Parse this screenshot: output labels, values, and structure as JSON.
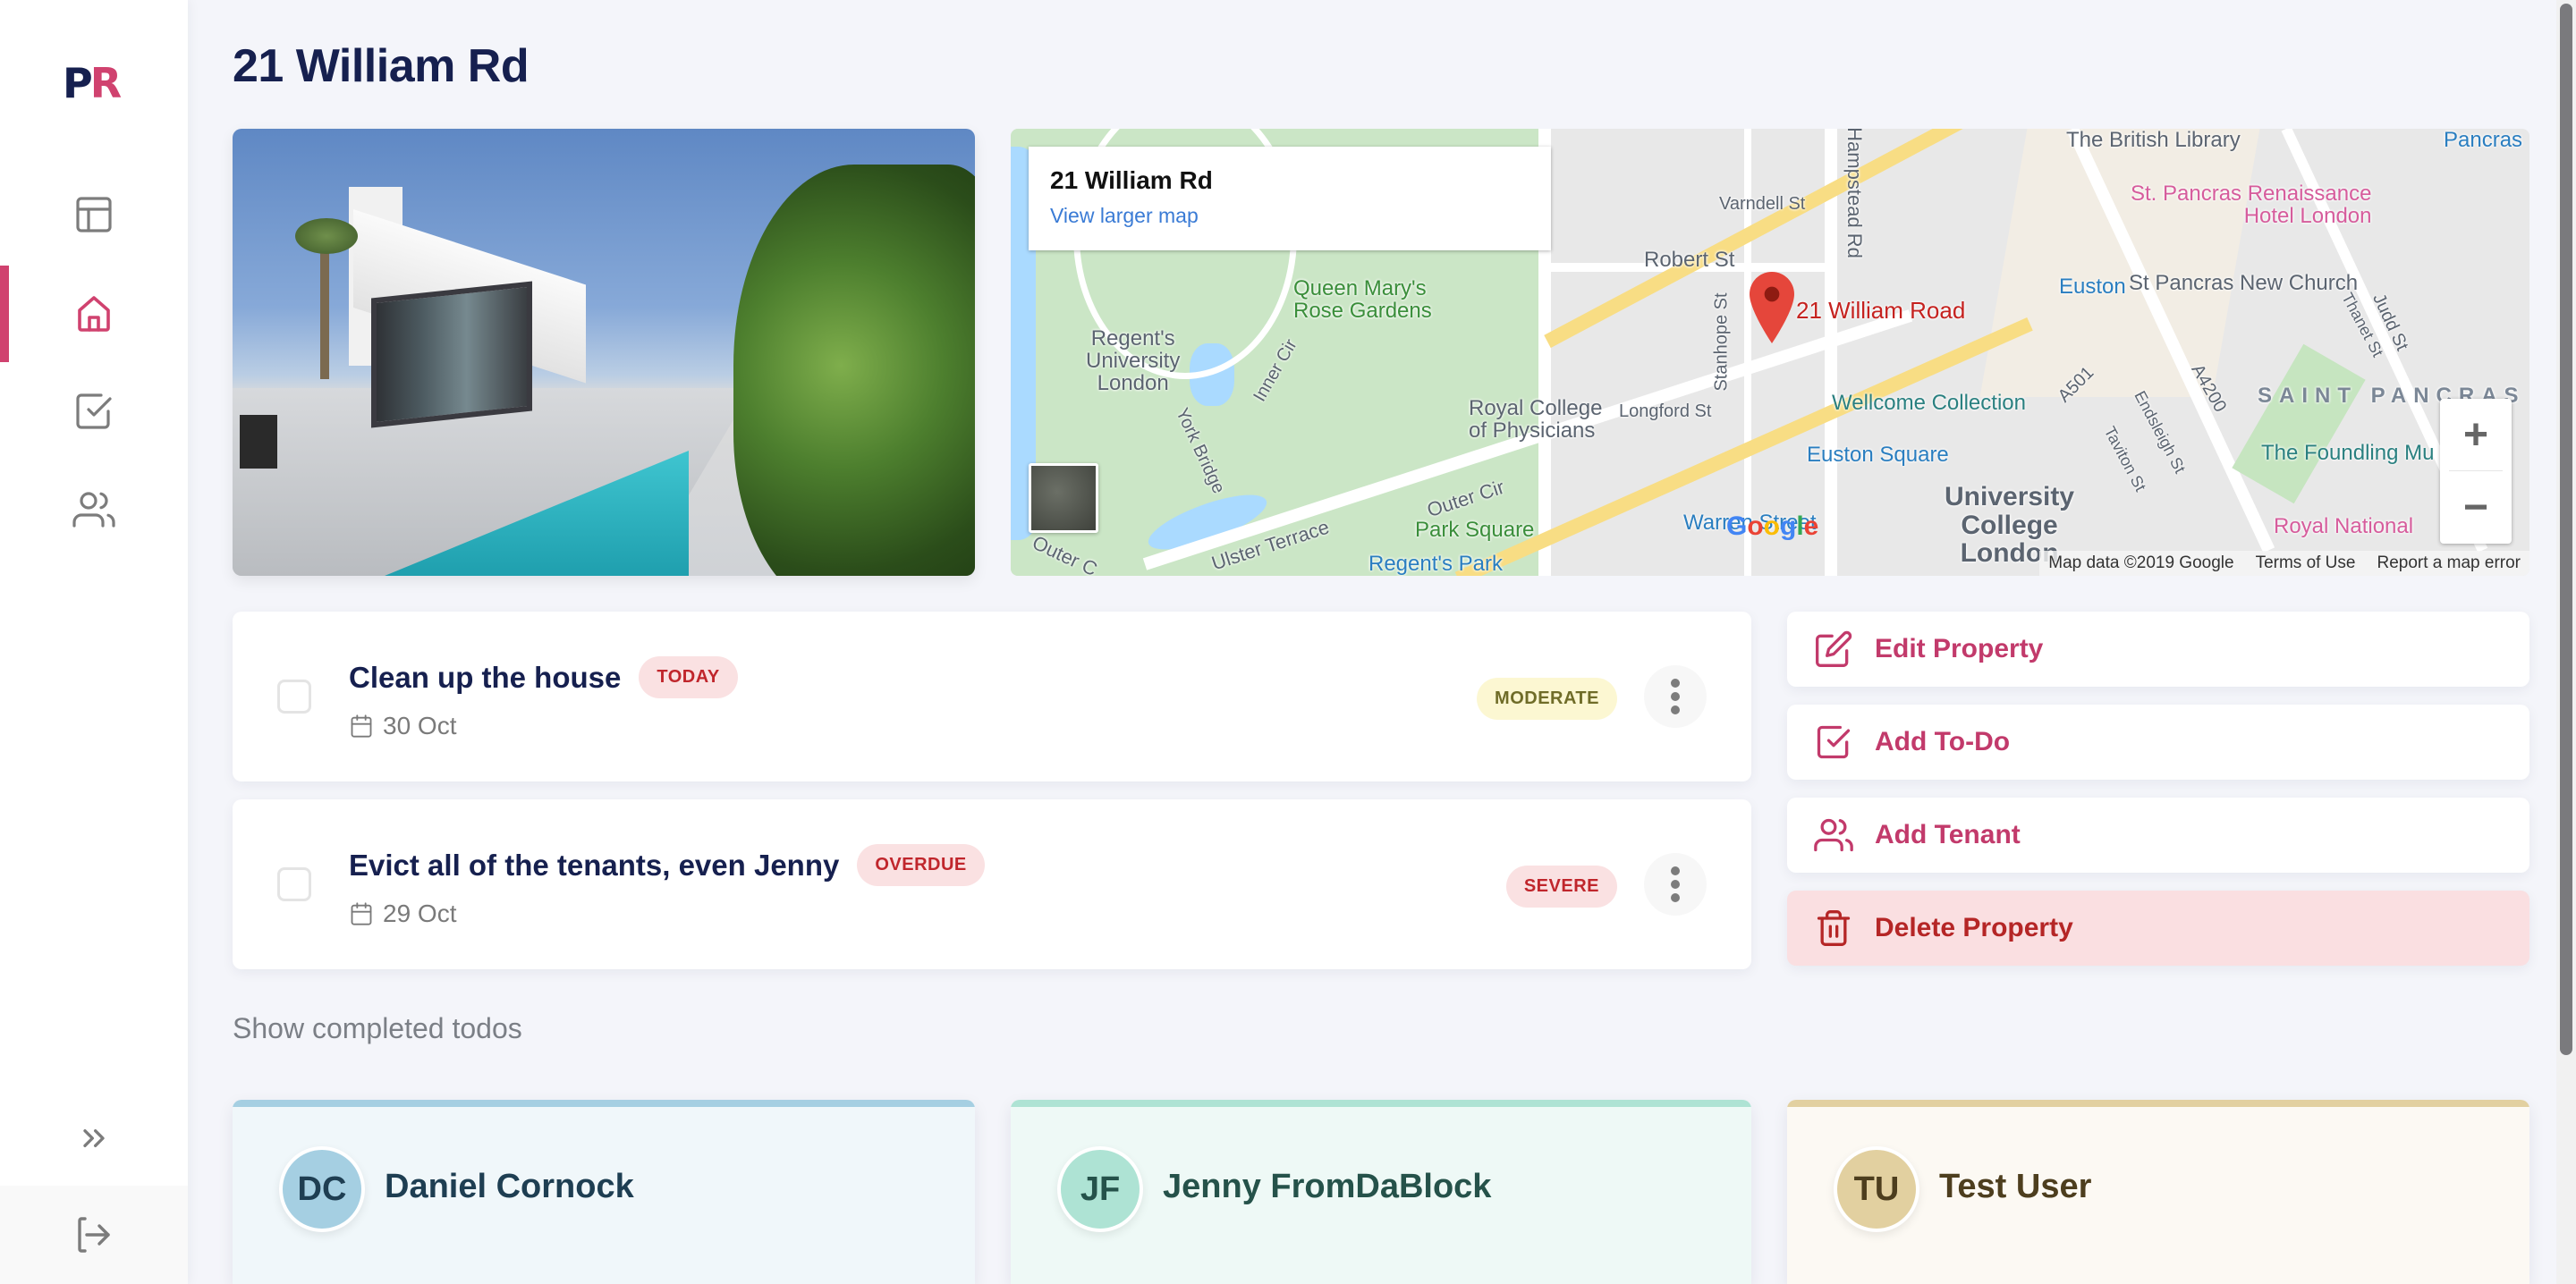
{
  "app": {
    "logo": {
      "first": "P",
      "second": "R"
    },
    "colors": {
      "brand_navy": "#16204f",
      "brand_pink": "#d0426f",
      "danger": "#b52626"
    }
  },
  "sidebar": {
    "items": [
      {
        "name": "dashboard",
        "icon": "layout-icon",
        "active": false
      },
      {
        "name": "properties",
        "icon": "home-icon",
        "active": true
      },
      {
        "name": "todos",
        "icon": "checkbox-icon",
        "active": false
      },
      {
        "name": "tenants",
        "icon": "users-icon",
        "active": false
      }
    ],
    "collapse_icon": "chevrons-right-icon",
    "logout_icon": "logout-icon"
  },
  "page": {
    "title": "21 William Rd"
  },
  "photo": {
    "alt": "Modern white house with pool"
  },
  "map": {
    "infobox": {
      "name": "21 William Rd",
      "link": "View larger map"
    },
    "pin_label": "21 William Road",
    "labels": {
      "queen_marys": "Queen Mary's\nRose Gardens",
      "regents_univ": "Regent's\nUniversity\nLondon",
      "royal_college": "Royal College\nof Physicians",
      "park_square": "Park Square",
      "regents_park": "Regent's Park",
      "ulster_terrace": "Ulster Terrace",
      "outer_cir": "Outer Cir",
      "outer_cir2": "Outer C",
      "inner_cir": "Inner Cir",
      "york_bridge": "York Bridge",
      "robert_st": "Robert St",
      "varndell_st": "Varndell St",
      "hampstead_rd": "Hampstead Rd",
      "stanhope_st": "Stanhope St",
      "longford_st": "Longford St",
      "wellcome": "Wellcome Collection",
      "euston_square": "Euston Square",
      "euston": "Euston",
      "warren_street": "Warren Street",
      "ucl": "University\nCollege\nLondon",
      "british_library": "The British Library",
      "st_pancras_hotel": "St. Pancras Renaissance\nHotel London",
      "st_pancras_church": "St Pancras New Church",
      "saint_pancras": "SAINT PANCRAS",
      "foundling": "The Foundling Mu",
      "royal_national": "Royal National",
      "a501": "A501",
      "a4200": "A4200",
      "endsleigh": "Endsleigh St",
      "taviton": "Taviton St",
      "thanet": "Thanet St",
      "judd": "Judd St",
      "pancras_top": "Pancras"
    },
    "zoom_in": "+",
    "zoom_out": "−",
    "google_logo": [
      "G",
      "o",
      "o",
      "g",
      "l",
      "e"
    ],
    "footer": {
      "data": "Map data ©2019 Google",
      "terms": "Terms of Use",
      "report": "Report a map error"
    }
  },
  "todos": [
    {
      "title": "Clean up the house",
      "status_badge": "TODAY",
      "date": "30 Oct",
      "severity": "MODERATE",
      "checked": false
    },
    {
      "title": "Evict all of the tenants, even Jenny",
      "status_badge": "OVERDUE",
      "date": "29 Oct",
      "severity": "SEVERE",
      "checked": false
    }
  ],
  "actions": [
    {
      "label": "Edit Property",
      "icon": "edit-icon"
    },
    {
      "label": "Add To-Do",
      "icon": "checkbox-icon"
    },
    {
      "label": "Add Tenant",
      "icon": "users-icon"
    },
    {
      "label": "Delete Property",
      "icon": "trash-icon",
      "danger": true
    }
  ],
  "show_completed": "Show completed todos",
  "tenants": [
    {
      "initials": "DC",
      "name": "Daniel Cornock",
      "color": "#a5cfe2"
    },
    {
      "initials": "JF",
      "name": "Jenny FromDaBlock",
      "color": "#aee3d4"
    },
    {
      "initials": "TU",
      "name": "Test User",
      "color": "#e2d0a0"
    }
  ]
}
